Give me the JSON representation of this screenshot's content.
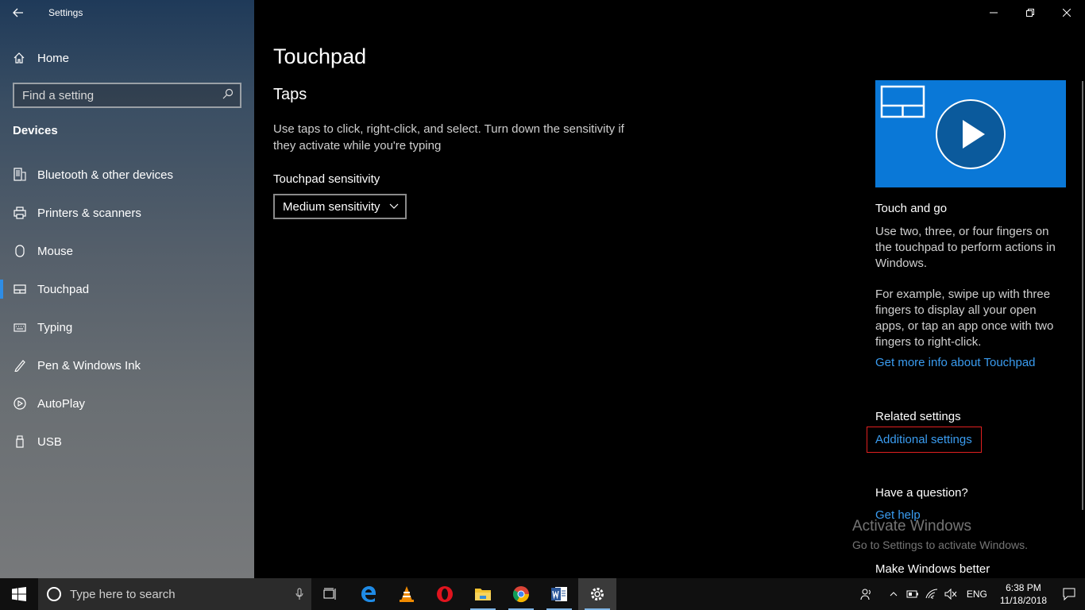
{
  "window": {
    "title": "Settings"
  },
  "sidebar": {
    "home_label": "Home",
    "search_placeholder": "Find a setting",
    "section": "Devices",
    "items": [
      {
        "label": "Bluetooth & other devices",
        "icon": "bluetooth-devices-icon"
      },
      {
        "label": "Printers & scanners",
        "icon": "printer-icon"
      },
      {
        "label": "Mouse",
        "icon": "mouse-icon"
      },
      {
        "label": "Touchpad",
        "icon": "touchpad-icon",
        "selected": true
      },
      {
        "label": "Typing",
        "icon": "keyboard-icon"
      },
      {
        "label": "Pen & Windows Ink",
        "icon": "pen-icon"
      },
      {
        "label": "AutoPlay",
        "icon": "autoplay-icon"
      },
      {
        "label": "USB",
        "icon": "usb-icon"
      }
    ]
  },
  "main": {
    "title": "Touchpad",
    "taps": {
      "heading": "Taps",
      "description": "Use taps to click, right-click, and select. Turn down the sensitivity if they activate while you're typing",
      "sensitivity_label": "Touchpad sensitivity",
      "sensitivity_value": "Medium sensitivity"
    }
  },
  "right_panel": {
    "video_heading": "Touch and go",
    "video_text1": "Use two, three, or four fingers on the touchpad to perform actions in Windows.",
    "video_text2": "For example, swipe up with three fingers to display all your open apps, or tap an app once with two fingers to right-click.",
    "more_info_link": "Get more info about Touchpad",
    "related_heading": "Related settings",
    "additional_link": "Additional settings",
    "question_heading": "Have a question?",
    "help_link": "Get help",
    "better_heading": "Make Windows better"
  },
  "watermark": {
    "line1": "Activate Windows",
    "line2": "Go to Settings to activate Windows."
  },
  "taskbar": {
    "search_placeholder": "Type here to search",
    "apps": [
      "task-view-icon",
      "edge-icon",
      "vlc-icon",
      "opera-icon",
      "file-explorer-icon",
      "chrome-icon",
      "word-icon",
      "settings-icon"
    ],
    "language": "ENG",
    "time": "6:38 PM",
    "date": "11/18/2018"
  },
  "colors": {
    "accent": "#0a78d7",
    "link": "#3a9cf0",
    "highlight_box": "#e02020"
  }
}
